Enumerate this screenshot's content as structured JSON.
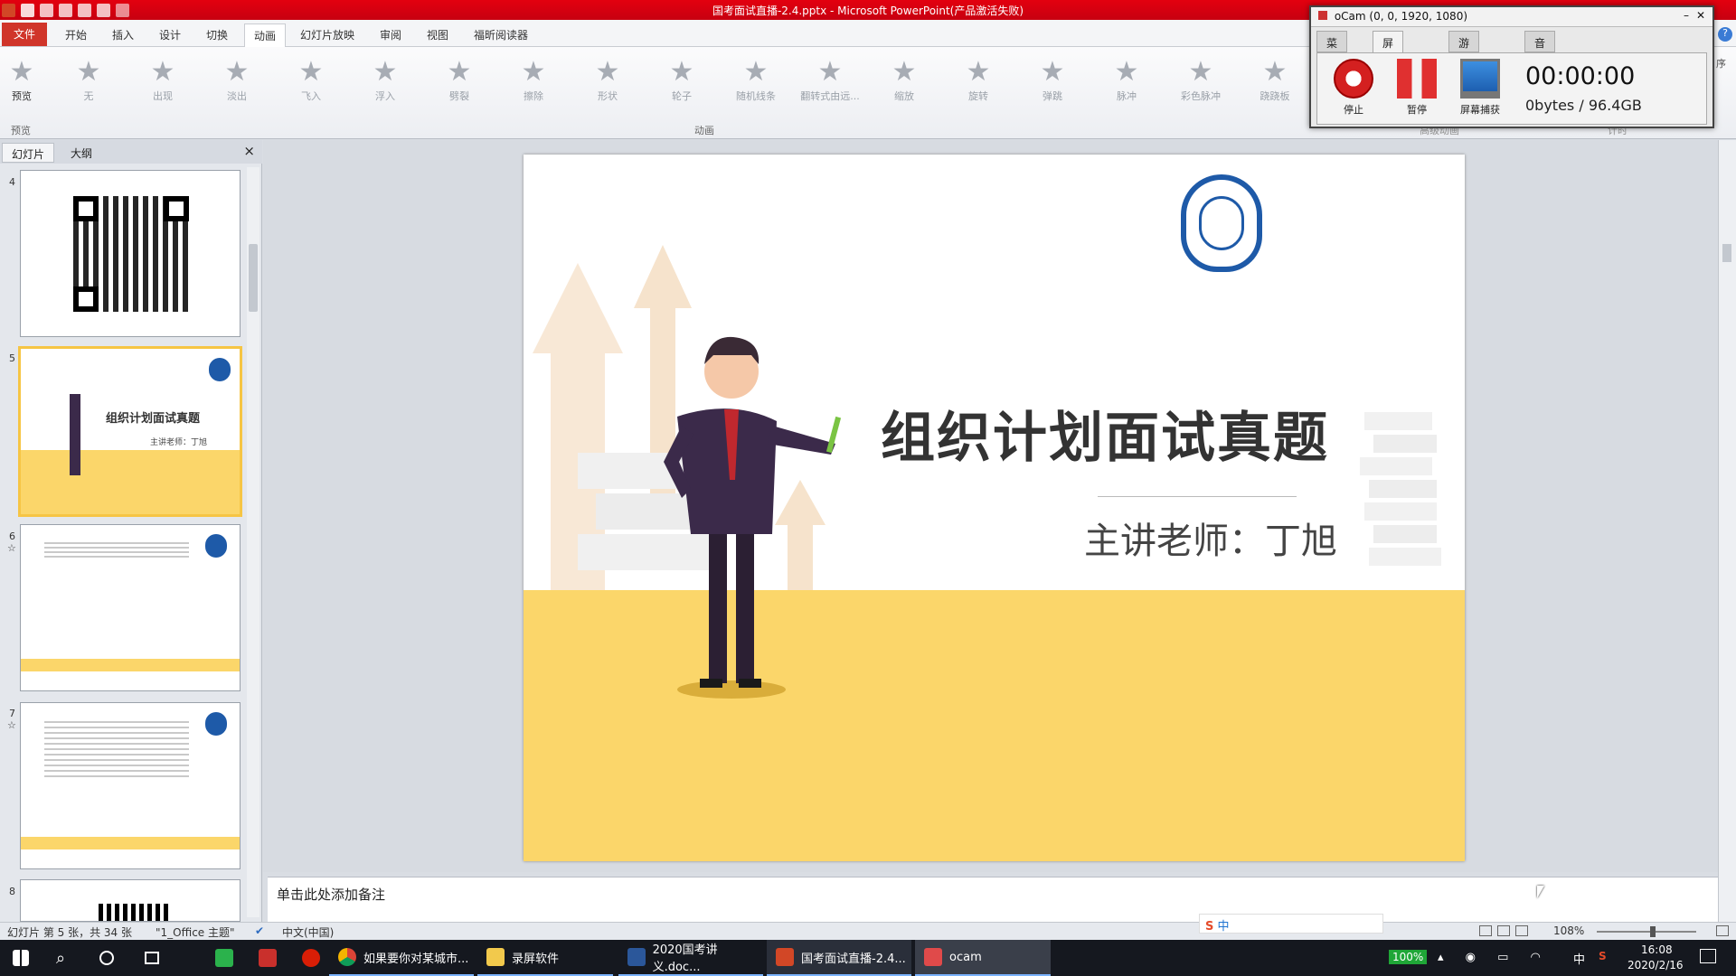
{
  "app": {
    "title": "国考面试直播-2.4.pptx - Microsoft PowerPoint(产品激活失败)",
    "colors": {
      "titlebar": "#d7000f",
      "file_tab": "#d0352a",
      "slide_yellow": "#fbd66a",
      "thumb_selected": "#f6c544"
    }
  },
  "ribbon_tabs": [
    "文件",
    "开始",
    "插入",
    "设计",
    "切换",
    "动画",
    "幻灯片放映",
    "审阅",
    "视图",
    "福昕阅读器"
  ],
  "ribbon_active_tab": "动画",
  "ribbon": {
    "preview_label": "预览",
    "preview_group": "预览",
    "animation_group": "动画",
    "advanced_group": "高级动画",
    "timing_group": "计时",
    "reorder_label": "序",
    "animations": [
      "无",
      "出现",
      "淡出",
      "飞入",
      "浮入",
      "劈裂",
      "擦除",
      "形状",
      "轮子",
      "随机线条",
      "翻转式由远...",
      "缩放",
      "旋转",
      "弹跳",
      "脉冲",
      "彩色脉冲",
      "跷跷板"
    ]
  },
  "left_pane": {
    "tab_slides": "幻灯片",
    "tab_outline": "大纲",
    "close": "×",
    "thumbnails": [
      {
        "num": "4"
      },
      {
        "num": "5",
        "title": "组织计划面试真题",
        "subtitle": "主讲老师：丁旭"
      },
      {
        "num": "6",
        "mark": "☆"
      },
      {
        "num": "7",
        "mark": "☆"
      },
      {
        "num": "8"
      }
    ]
  },
  "slide": {
    "title": "组织计划面试真题",
    "subtitle": "主讲老师：丁旭"
  },
  "notes_placeholder": "单击此处添加备注",
  "status": {
    "slide_info": "幻灯片 第 5 张，共 34 张",
    "theme": "\"1_Office 主题\"",
    "language": "中文(中国)",
    "zoom": "108%"
  },
  "ocam": {
    "title": "oCam (0, 0, 1920, 1080)",
    "tabs": [
      "菜单",
      "屏幕录制",
      "游戏录制",
      "音频录制"
    ],
    "active_tab": "屏幕录制",
    "buttons": [
      "停止",
      "暂停",
      "屏幕捕获"
    ],
    "timer": "00:00:00",
    "bytes": "0bytes / 96.4GB"
  },
  "taskbar": {
    "items": [
      "如果要你对某城市...",
      "录屏软件",
      "2020国考讲义.doc...",
      "国考面试直播-2.4...",
      "ocam"
    ],
    "battery": "100%",
    "ime": "中",
    "time": "16:08",
    "date": "2020/2/16"
  }
}
